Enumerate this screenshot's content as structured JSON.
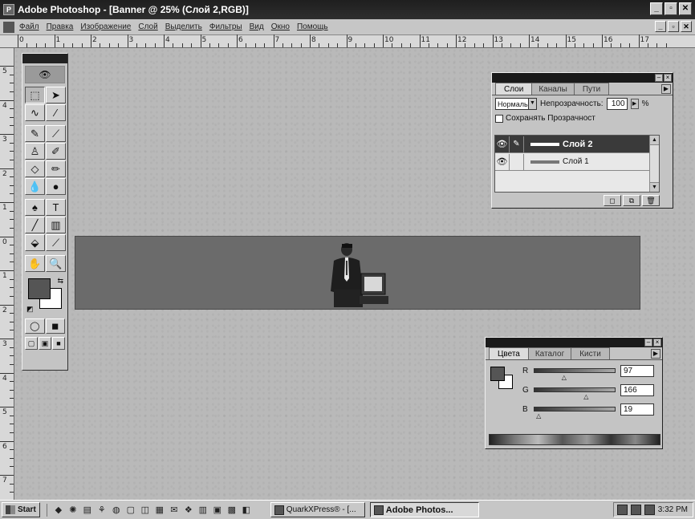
{
  "window": {
    "title": "Adobe Photoshop - [Banner @ 25% (Слой 2,RGB)]",
    "controls": [
      "_",
      "▫",
      "✕"
    ]
  },
  "menubar": {
    "items": [
      "Файл",
      "Правка",
      "Изображение",
      "Слой",
      "Выделить",
      "Фильтры",
      "Вид",
      "Окно",
      "Помощь"
    ],
    "doc_controls": [
      "_",
      "▫",
      "✕"
    ]
  },
  "ruler": {
    "top_labels": [
      "0",
      "1",
      "2",
      "3",
      "4",
      "5",
      "6",
      "7",
      "8",
      "9",
      "10",
      "11",
      "12",
      "13",
      "14",
      "15",
      "16",
      "17"
    ],
    "left_labels": [
      "5",
      "4",
      "3",
      "2",
      "1",
      "0",
      "1",
      "2",
      "3",
      "4",
      "5",
      "6",
      "7"
    ]
  },
  "toolbox": {
    "tools": [
      {
        "name": "marquee-tool",
        "glyph": "⬚"
      },
      {
        "name": "move-tool",
        "glyph": "➤"
      },
      {
        "name": "lasso-tool",
        "glyph": "∿"
      },
      {
        "name": "magic-wand-tool",
        "glyph": "⁄"
      },
      {
        "name": "airbrush-tool",
        "glyph": "✎"
      },
      {
        "name": "paintbrush-tool",
        "glyph": "⟋"
      },
      {
        "name": "rubber-stamp-tool",
        "glyph": "♙"
      },
      {
        "name": "history-brush-tool",
        "glyph": "✐"
      },
      {
        "name": "eraser-tool",
        "glyph": "◇"
      },
      {
        "name": "pencil-tool",
        "glyph": "✏"
      },
      {
        "name": "blur-tool",
        "glyph": "💧"
      },
      {
        "name": "zoom-dodge-tool",
        "glyph": "●"
      },
      {
        "name": "pen-tool",
        "glyph": "♠"
      },
      {
        "name": "type-tool",
        "glyph": "T"
      },
      {
        "name": "line-tool",
        "glyph": "╱"
      },
      {
        "name": "gradient-tool",
        "glyph": "▥"
      },
      {
        "name": "paint-bucket-tool",
        "glyph": "⬙"
      },
      {
        "name": "eyedropper-tool",
        "glyph": "⟋"
      },
      {
        "name": "hand-tool",
        "glyph": "✋"
      },
      {
        "name": "zoom-tool",
        "glyph": "🔍"
      }
    ],
    "modes": [
      "◯",
      "◼"
    ],
    "screens": [
      "▢",
      "▣",
      "■"
    ]
  },
  "layers_palette": {
    "tabs": [
      "Слои",
      "Каналы",
      "Пути"
    ],
    "blend_mode": "Нормаль",
    "opacity_label": "Непрозрачность:",
    "opacity_value": "100",
    "pct": "%",
    "preserve_label": "Сохранять Прозрачност",
    "layers": [
      {
        "name": "Слой 2",
        "selected": true
      },
      {
        "name": "Слой 1",
        "selected": false
      }
    ]
  },
  "color_palette": {
    "tabs": [
      "Цвета",
      "Каталог",
      "Кисти"
    ],
    "channels": [
      {
        "label": "R",
        "value": "97",
        "position": 0.38
      },
      {
        "label": "G",
        "value": "166",
        "position": 0.65
      },
      {
        "label": "B",
        "value": "19",
        "position": 0.07
      }
    ]
  },
  "taskbar": {
    "start_label": "Start",
    "quick_launch": [
      "◆",
      "✺",
      "▤",
      "⚘",
      "◍",
      "▢",
      "◫",
      "▦",
      "✉",
      "❖",
      "▥",
      "▣",
      "▩",
      "◧"
    ],
    "tasks": [
      {
        "label": "QuarkXPress® - [...",
        "active": false
      },
      {
        "label": "Adobe Photos...",
        "active": true
      }
    ],
    "clock": "3:32 PM"
  }
}
